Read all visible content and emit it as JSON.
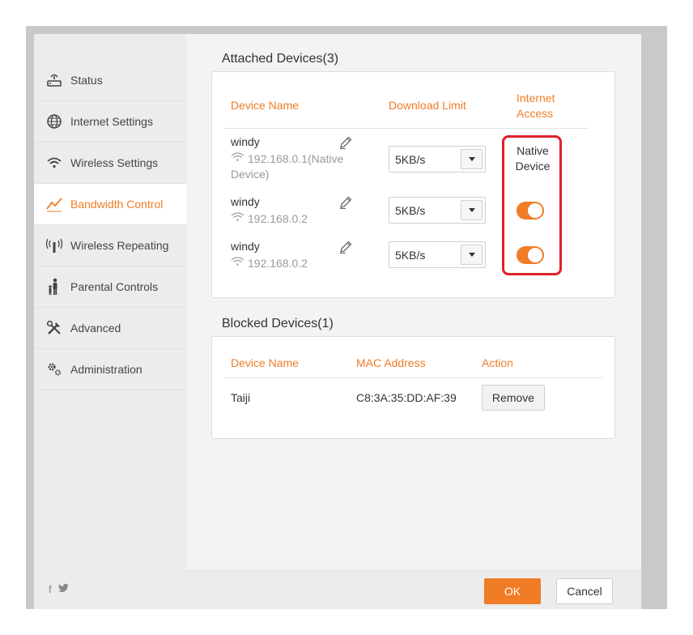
{
  "sidebar": {
    "items": [
      {
        "label": "Status",
        "icon": "router-icon"
      },
      {
        "label": "Internet Settings",
        "icon": "globe-icon"
      },
      {
        "label": "Wireless Settings",
        "icon": "wifi-icon"
      },
      {
        "label": "Bandwidth Control",
        "icon": "bandwidth-chart-icon",
        "active": true
      },
      {
        "label": "Wireless Repeating",
        "icon": "repeater-icon"
      },
      {
        "label": "Parental Controls",
        "icon": "parent-child-icon"
      },
      {
        "label": "Advanced",
        "icon": "tools-icon"
      },
      {
        "label": "Administration",
        "icon": "gears-icon"
      }
    ],
    "social": {
      "facebook": "f",
      "twitter": "🐦"
    }
  },
  "attached": {
    "title": "Attached Devices(3)",
    "headers": {
      "name": "Device Name",
      "limit": "Download Limit",
      "access": "Internet Access"
    },
    "access_header_lines": [
      "Internet",
      "Access"
    ],
    "devices": [
      {
        "name": "windy",
        "ip_lines": [
          "192.168.0.1(Native",
          "Device)"
        ],
        "limit": "5KB/s",
        "access_lines": [
          "Native",
          "Device"
        ]
      },
      {
        "name": "windy",
        "ip_lines": [
          "192.168.0.2"
        ],
        "limit": "5KB/s",
        "access_on": true
      },
      {
        "name": "windy",
        "ip_lines": [
          "192.168.0.2"
        ],
        "limit": "5KB/s",
        "access_on": true
      }
    ]
  },
  "blocked": {
    "title": "Blocked Devices(1)",
    "headers": {
      "name": "Device Name",
      "mac": "MAC Address",
      "action": "Action"
    },
    "devices": [
      {
        "name": "Taiji",
        "mac": "C8:3A:35:DD:AF:39",
        "action": "Remove"
      }
    ]
  },
  "footer": {
    "ok": "OK",
    "cancel": "Cancel"
  },
  "colors": {
    "accent": "#f07c26",
    "highlight": "#e0202a"
  }
}
